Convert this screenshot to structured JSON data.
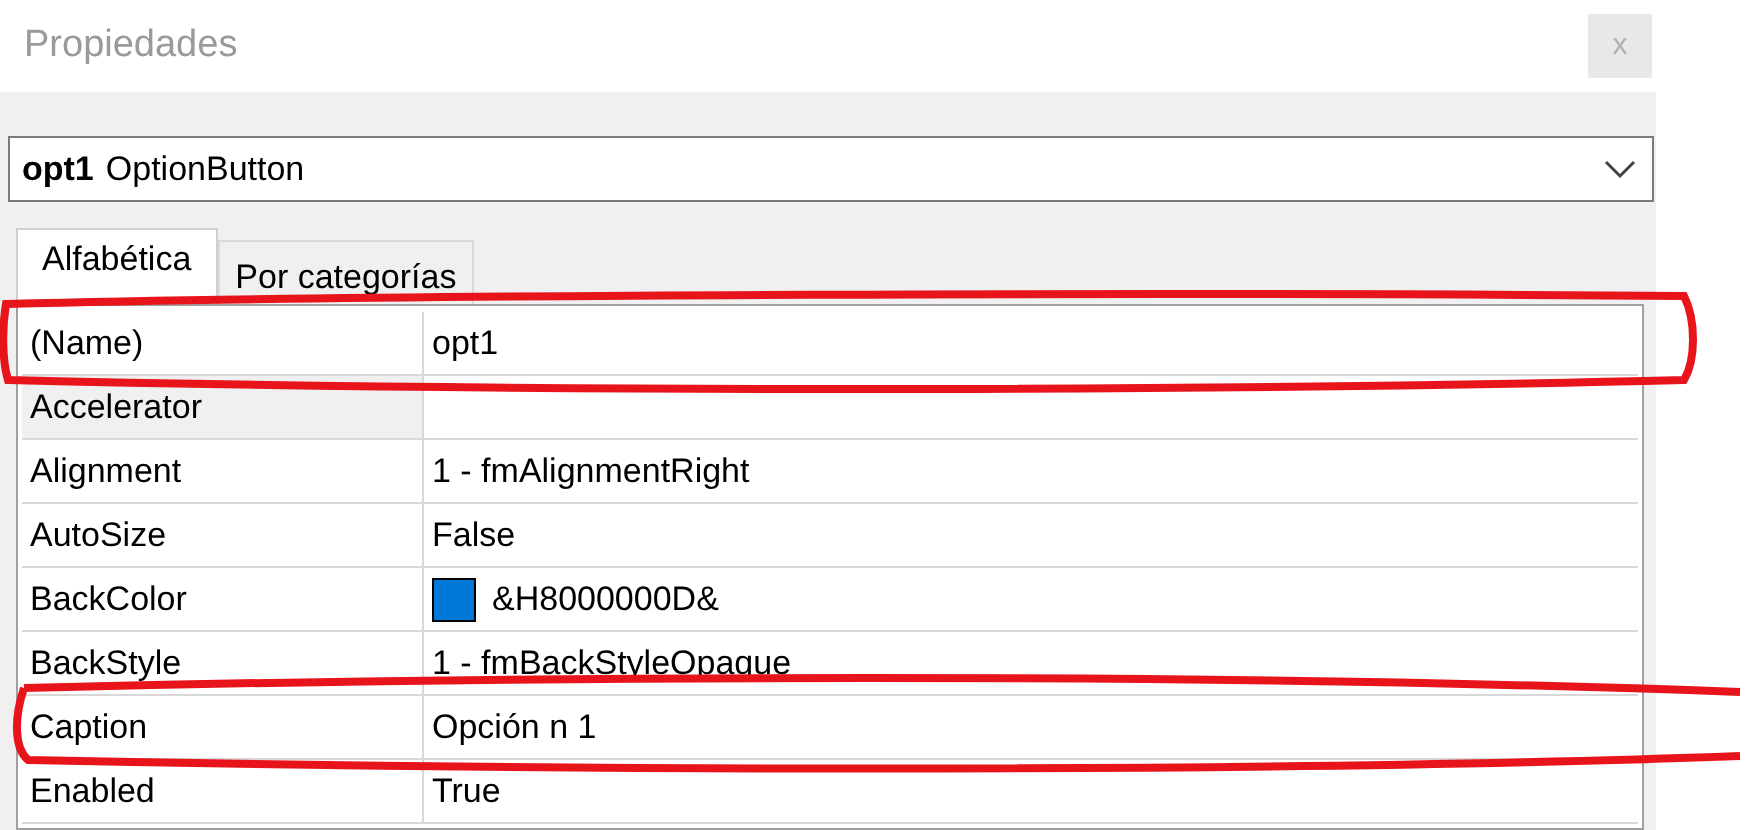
{
  "window": {
    "title": "Propiedades",
    "close": "x"
  },
  "object_selector": {
    "name": "opt1",
    "type": "OptionButton"
  },
  "tabs": [
    {
      "label": "Alfabética",
      "selected": true
    },
    {
      "label": "Por categorías",
      "selected": false
    }
  ],
  "properties": [
    {
      "name": "(Name)",
      "value": "opt1",
      "selected": false
    },
    {
      "name": "Accelerator",
      "selected": true
    },
    {
      "name": "Alignment",
      "value": "1 - fmAlignmentRight",
      "selected": false
    },
    {
      "name": "AutoSize",
      "value": "False",
      "selected": false
    },
    {
      "name": "BackColor",
      "value": "&H8000000D&",
      "color": "#0078d7",
      "selected": false
    },
    {
      "name": "BackStyle",
      "value": "1 - fmBackStyleOpaque",
      "selected": false
    },
    {
      "name": "Caption",
      "value": "Opción n 1",
      "selected": false
    },
    {
      "name": "Enabled",
      "value": "True",
      "selected": false
    }
  ]
}
